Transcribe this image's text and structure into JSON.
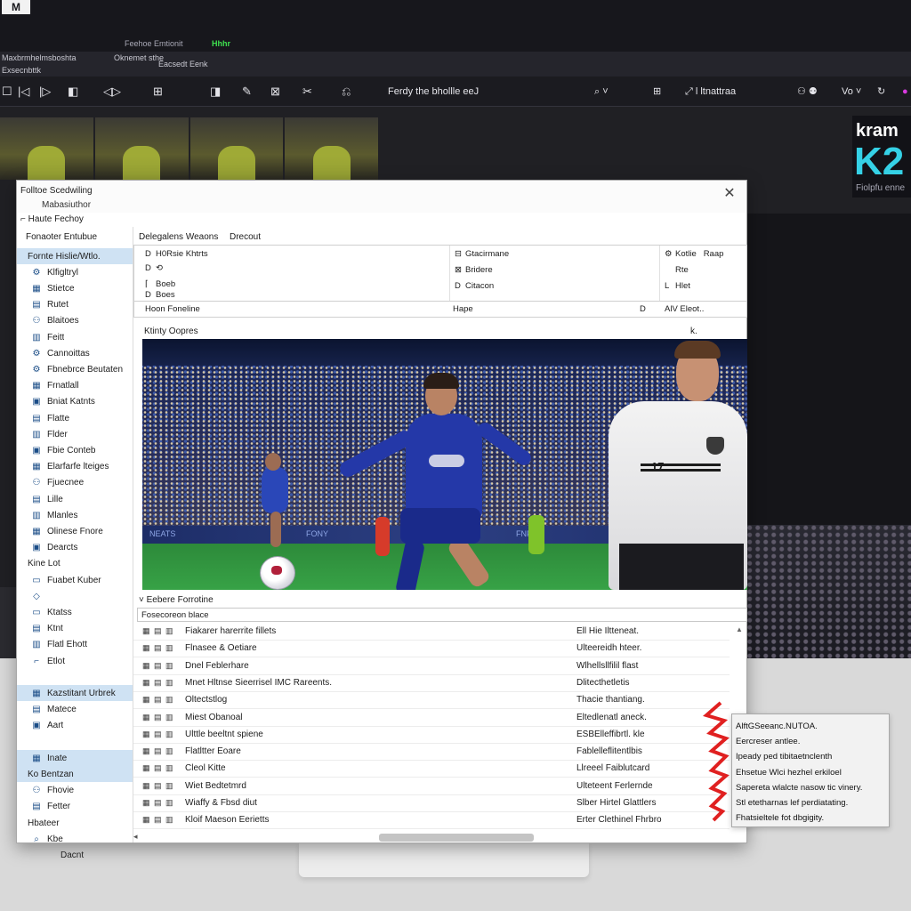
{
  "host": {
    "logo": "M",
    "title": "Feehoe Emtionit",
    "badge": "Hhhr",
    "menu": [
      "Maxbrmhelmsboshta",
      "Oknemet sthe",
      "Exsecnbttk",
      "Eacsedt Eenk"
    ],
    "toolbar": {
      "buttons": [
        "☐",
        "|◁",
        "|▷",
        "◧",
        "≡",
        "◁▷",
        "⊞",
        "⌕",
        "◨",
        "✎",
        "⊠",
        "✂",
        "⎌"
      ],
      "center_text": "Ferdy the bhollle eeJ",
      "right_items": [
        "⌕ ˅",
        "⊞",
        "⤢ l ltnattraa",
        "⚇ ⚉",
        "Vo ˅",
        "↻",
        "●"
      ]
    },
    "brand": {
      "top": "kram",
      "main": "K2",
      "sub": "Fiolpfu enne"
    }
  },
  "dialog": {
    "title": "Folltoe Scedwiling",
    "subtitle": "Mabasiuthor",
    "path": "Haute Fechoy",
    "close_icon": "✕"
  },
  "sidebar": {
    "heading": "Fonaoter Entubue",
    "items": [
      {
        "label": "Fornte Hislie/Wtlo.",
        "icon": "",
        "selected": true
      },
      {
        "label": "Klfigltryl",
        "icon": "⚙",
        "selected": false
      },
      {
        "label": "Stietce",
        "icon": "▦",
        "selected": false
      },
      {
        "label": "Rutet",
        "icon": "▤",
        "selected": false
      },
      {
        "label": "Blaitoes",
        "icon": "⚇",
        "selected": false
      },
      {
        "label": "Feitt",
        "icon": "▥",
        "selected": false
      },
      {
        "label": "Cannoittas",
        "icon": "⚙",
        "selected": false
      },
      {
        "label": "Fbnebrce Beutaten",
        "icon": "⚙",
        "selected": false
      },
      {
        "label": "Frnatlall",
        "icon": "▦",
        "selected": false
      },
      {
        "label": "Bniat Katnts",
        "icon": "▣",
        "selected": false
      },
      {
        "label": "Flatte",
        "icon": "▤",
        "selected": false
      },
      {
        "label": "Flder",
        "icon": "▥",
        "selected": false
      },
      {
        "label": "Fbie Conteb",
        "icon": "▣",
        "selected": false
      },
      {
        "label": "Elarfarfe lteiges",
        "icon": "▦",
        "selected": false
      },
      {
        "label": "Fjuecnee",
        "icon": "⚇",
        "selected": false
      },
      {
        "label": "Lille",
        "icon": "▤",
        "selected": false
      },
      {
        "label": "Mlanles",
        "icon": "▥",
        "selected": false
      },
      {
        "label": "Olinese Fnore",
        "icon": "▦",
        "selected": false
      },
      {
        "label": "Dearcts",
        "icon": "▣",
        "selected": false
      },
      {
        "label": "Kine Lot",
        "icon": "",
        "selected": false,
        "plain": true
      },
      {
        "label": "Fuabet Kuber",
        "icon": "▭",
        "selected": false
      },
      {
        "label": "",
        "icon": "◇",
        "selected": false
      },
      {
        "label": "Ktatss",
        "icon": "▭",
        "selected": false
      },
      {
        "label": "Ktnt",
        "icon": "▤",
        "selected": false
      },
      {
        "label": "Flatl Ehott",
        "icon": "▥",
        "selected": false
      },
      {
        "label": "Etlot",
        "icon": "⌐",
        "selected": false
      },
      {
        "label": "",
        "icon": "",
        "selected": false,
        "plain": true
      },
      {
        "label": "Kazstitant Urbrek",
        "icon": "▦",
        "selected": true
      },
      {
        "label": "Matece",
        "icon": "▤",
        "selected": false
      },
      {
        "label": "Aart",
        "icon": "▣",
        "selected": false
      },
      {
        "label": "",
        "icon": "",
        "selected": false,
        "plain": true
      },
      {
        "label": "Inate",
        "icon": "▦",
        "selected": true
      },
      {
        "label": "Ko Bentzan",
        "icon": "",
        "selected": true,
        "plain": true
      },
      {
        "label": "Fhovie",
        "icon": "⚇",
        "selected": false
      },
      {
        "label": "Fetter",
        "icon": "▤",
        "selected": false
      },
      {
        "label": "Hbateer",
        "icon": "",
        "selected": false,
        "plain": true
      },
      {
        "label": "Kbe",
        "icon": "⌕",
        "selected": false
      }
    ],
    "footer": "Dacnt"
  },
  "main": {
    "tabs": [
      "Delegalens Weaons",
      "Drecout"
    ],
    "props_left": [
      {
        "icon": "D",
        "text": "H0Rsie Khtrts"
      },
      {
        "icon": "D",
        "text": "⟲"
      },
      {
        "icon": "⌈",
        "text": "Boeb"
      },
      {
        "icon": "D",
        "text": "Boes"
      }
    ],
    "props_mid": [
      {
        "icon": "⊟",
        "text": "Gtacirmane"
      },
      {
        "icon": "⊠",
        "text": "Bridere"
      },
      {
        "icon": "D",
        "text": "Citacon"
      }
    ],
    "props_right": [
      {
        "icon": "⚙",
        "text": "Kotlie",
        "extra": "Raap"
      },
      {
        "icon": "",
        "text": "Rte"
      },
      {
        "icon": "L",
        "text": "Hlet"
      }
    ],
    "fieldbar": {
      "left": "Hoon Foneline",
      "mid": "Hape",
      "d": "D",
      "right": "AlV Eleot.."
    },
    "preview_label": "Ktinty Oopres",
    "preview_k": "k.",
    "adboard": [
      "NEATS",
      "FONY",
      "FNF"
    ],
    "keeper_number": "17",
    "list_label": "Eebere Forrotine",
    "list_header": "Fosecoreon blace",
    "rows": [
      {
        "name": "Fiakarer harerrite fillets",
        "type": "Ell Hie Iltteneat."
      },
      {
        "name": "Flnasee & Oetiare",
        "type": "Ulteereidh hteer."
      },
      {
        "name": "Dnel Feblerhare",
        "type": "Wlhellsllfilil flast"
      },
      {
        "name": "Mnet Hltnse Sieerrisel IMC Rareents.",
        "type": "Dlitecthetletis"
      },
      {
        "name": "Oltectstlog",
        "type": "Thacie thantiang."
      },
      {
        "name": "Miest Obanoal",
        "type": "Eltedlenatl aneck."
      },
      {
        "name": "Ulttle beeltnt spiene",
        "type": "ESBElleffibrtl. kle"
      },
      {
        "name": "Flatltter Eoare",
        "type": "Fablelleflitentlbis"
      },
      {
        "name": "Cleol Kitte",
        "type": "Llreeel Faiblutcard"
      },
      {
        "name": "Wiet Bedtetmrd",
        "type": "Ulteteent Ferlernde"
      },
      {
        "name": "Wiaffy & Fbsd diut",
        "type": "Slber Hirtel Glattlers"
      },
      {
        "name": "Kloif Maeson Eerietts",
        "type": "Erter Clethinel Fhrbro"
      }
    ],
    "scroll_up": "▲",
    "scroll_down": "▼",
    "hscroll_left": "◂"
  },
  "callout": {
    "lines": [
      "AlftGSeeanc.NUTOA.",
      "Eercreser antlee.",
      "Ipeady ped tibitaetnclenth",
      "Ehsetue Wlci hezhel erkiloel",
      "Sapereta wlalcte nasow tic vinery.",
      "Stl etetharnas lef perdiatating.",
      "Fhatsieltele fot dbgigity."
    ]
  },
  "below_label": "Dacnt"
}
